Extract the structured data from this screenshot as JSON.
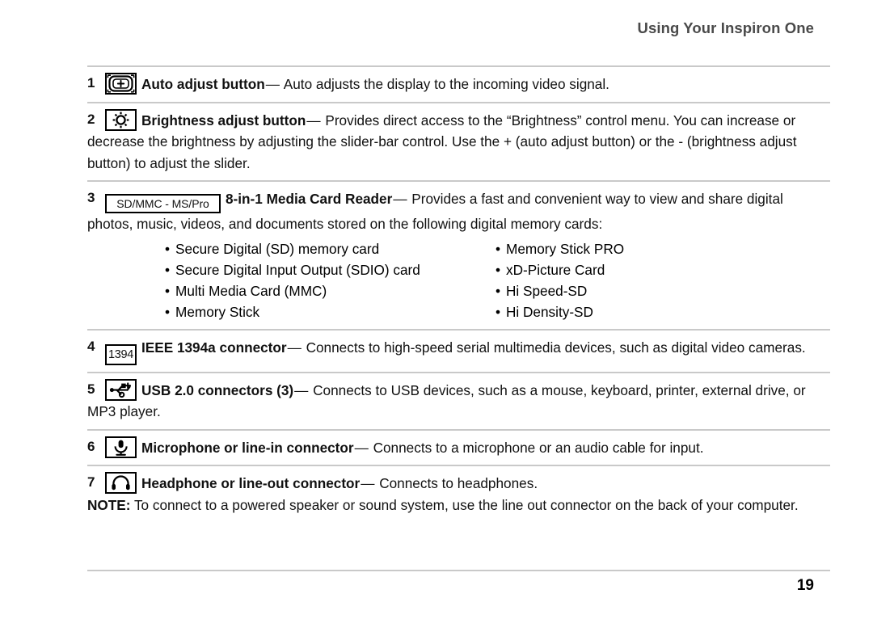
{
  "header": {
    "title": "Using Your Inspiron One"
  },
  "footer": {
    "page_number": "19"
  },
  "entries": [
    {
      "number": "1",
      "icon": "auto-adjust-icon",
      "term": "Auto adjust button",
      "dash": "—",
      "description": "Auto adjusts the display to the incoming video signal."
    },
    {
      "number": "2",
      "icon": "brightness-icon",
      "term": "Brightness adjust button",
      "dash": "—",
      "description": "Provides direct access to the “Brightness” control menu. You can increase or decrease the brightness by adjusting the slider-bar control. Use the + (auto adjust button) or the - (brightness adjust button) to adjust the slider."
    },
    {
      "number": "3",
      "icon": "media-card-reader-icon",
      "icon_label": "SD/MMC - MS/Pro",
      "term": "8-in-1 Media Card Reader",
      "dash": "—",
      "description": "Provides a fast and convenient way to view and share digital photos, music, videos, and documents stored on the following digital memory cards:"
    },
    {
      "number": "4",
      "icon": "ieee-1394-icon",
      "icon_label": "1394",
      "term": "IEEE 1394a connector",
      "dash": "—",
      "description": "Connects to high-speed serial multimedia devices, such as digital video cameras."
    },
    {
      "number": "5",
      "icon": "usb-icon",
      "term": "USB 2.0 connectors (3)",
      "dash": "—",
      "description": "Connects to USB devices, such as a mouse, keyboard, printer, external drive, or MP3 player."
    },
    {
      "number": "6",
      "icon": "microphone-icon",
      "term": "Microphone or line-in connector",
      "dash": "—",
      "description": "Connects to a microphone or an audio cable for input."
    },
    {
      "number": "7",
      "icon": "headphone-icon",
      "term": "Headphone or line-out connector",
      "dash": "—",
      "description": "Connects to headphones.",
      "note_label": "NOTE:",
      "note_text": "To connect to a powered speaker or sound system, use the line out connector on the back of your computer."
    }
  ],
  "card_list": {
    "bullet": "•",
    "left_column": [
      "Secure Digital (SD) memory card",
      "Secure Digital Input Output (SDIO) card",
      "Multi Media Card (MMC)",
      "Memory Stick"
    ],
    "right_column": [
      "Memory Stick PRO",
      "xD-Picture Card",
      "Hi Speed-SD",
      "Hi Density-SD"
    ]
  },
  "colors": {
    "header_text": "#4a4a4a",
    "rule": "#c9c9c9",
    "body_text": "#111111"
  }
}
